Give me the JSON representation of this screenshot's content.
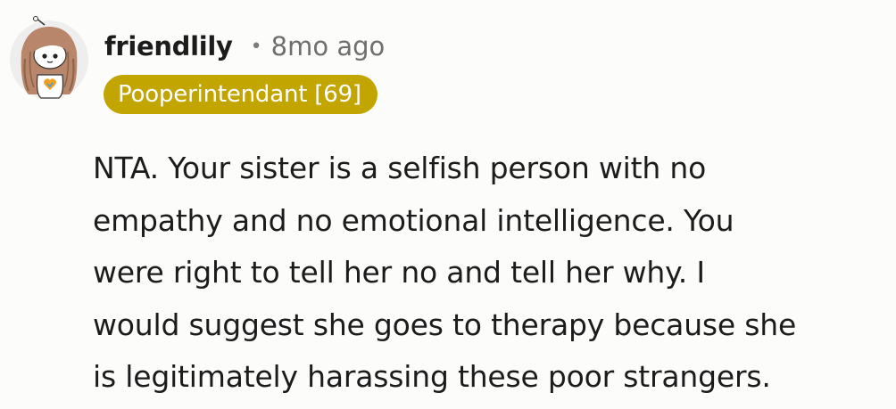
{
  "comment": {
    "author": "friendlily",
    "separator": "•",
    "timestamp": "8mo ago",
    "flair": "Pooperintendant [69]",
    "flair_color": "#c3a500",
    "avatar_icon": "snoo-avatar-icon",
    "body_lines": [
      "NTA. Your sister is a selfish person with no",
      "empathy and no emotional intelligence. You",
      "were right to tell her no and tell her why. I",
      "would suggest she goes to therapy because she",
      "is legitimately harassing these poor strangers."
    ]
  }
}
